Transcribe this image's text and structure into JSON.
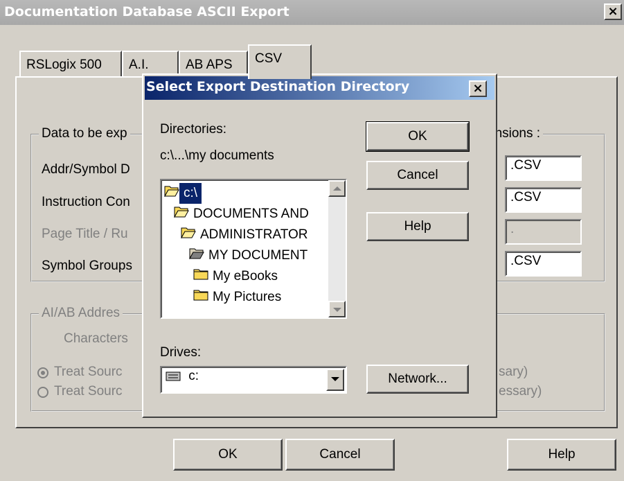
{
  "window": {
    "title": "Documentation Database ASCII Export"
  },
  "tabs": [
    {
      "label": "RSLogix 500"
    },
    {
      "label": "A.I."
    },
    {
      "label": "AB APS"
    },
    {
      "label": "CSV"
    }
  ],
  "data_group": {
    "label": "Data to be exp",
    "rows": [
      {
        "label": "Addr/Symbol D",
        "ext": ".CSV"
      },
      {
        "label": "Instruction Con",
        "ext": ".CSV"
      },
      {
        "label": "Page Title / Ru",
        "ext": "."
      },
      {
        "label": "Symbol Groups",
        "ext": ".CSV"
      }
    ],
    "ext_label": "ensions :"
  },
  "ab_group": {
    "label": "AI/AB Addres",
    "characters_label": "Characters",
    "radio1": "Treat Sourc",
    "radio1_tail": "sary)",
    "radio2": "Treat Sourc",
    "radio2_tail": "essary)"
  },
  "bottom_buttons": {
    "ok": "OK",
    "cancel": "Cancel",
    "help": "Help"
  },
  "dialog": {
    "title": "Select Export Destination Directory",
    "directories_label": "Directories:",
    "current_path": "c:\\...\\my documents",
    "directories": [
      {
        "name": "c:\\",
        "icon": "open-folder-icon",
        "selected": true
      },
      {
        "name": "DOCUMENTS AND",
        "icon": "open-folder-icon",
        "selected": false
      },
      {
        "name": "ADMINISTRATOR",
        "icon": "open-folder-icon",
        "selected": false
      },
      {
        "name": "MY DOCUMENT",
        "icon": "open-folder-icon",
        "selected": false
      },
      {
        "name": "My eBooks",
        "icon": "folder-icon",
        "selected": false
      },
      {
        "name": "My Pictures",
        "icon": "folder-icon",
        "selected": false
      }
    ],
    "drives_label": "Drives:",
    "drive_value": "c:",
    "buttons": {
      "ok": "OK",
      "cancel": "Cancel",
      "help": "Help",
      "network": "Network..."
    }
  }
}
